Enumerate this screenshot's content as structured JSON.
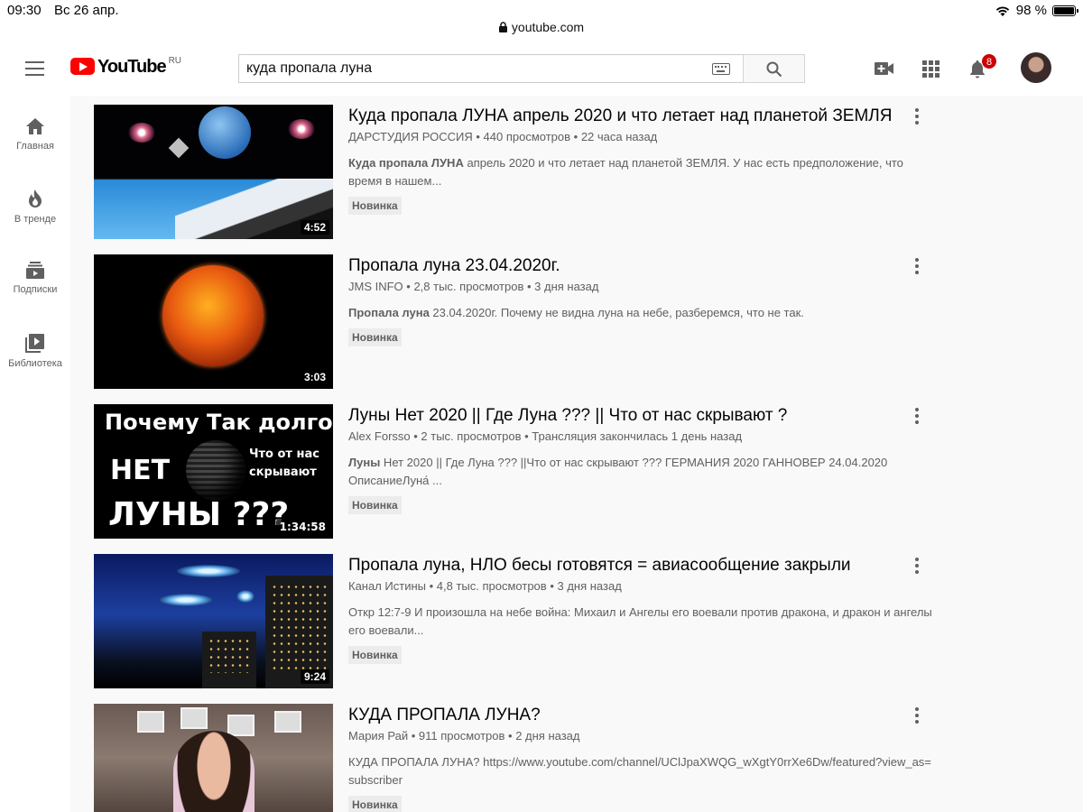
{
  "status_bar": {
    "time": "09:30",
    "date": "Вс 26 апр.",
    "battery": "98 %"
  },
  "url": "youtube.com",
  "logo": {
    "word": "YouTube",
    "country": "RU"
  },
  "search": {
    "query": "куда пропала луна"
  },
  "notifications_count": "8",
  "sidebar": {
    "items": [
      {
        "label": "Главная",
        "icon": "home-icon"
      },
      {
        "label": "В тренде",
        "icon": "flame-icon"
      },
      {
        "label": "Подписки",
        "icon": "subscriptions-icon"
      },
      {
        "label": "Библиотека",
        "icon": "library-icon"
      }
    ]
  },
  "results": [
    {
      "title": "Куда пропала ЛУНА апрель 2020 и что летает над планетой ЗЕМЛЯ",
      "channel": "ДАРСТУДИЯ РОССИЯ",
      "views": "440 просмотров",
      "age": "22 часа назад",
      "desc_bold": "Куда пропала ЛУНА",
      "desc_rest": " апрель 2020 и что летает над планетой ЗЕМЛЯ. У нас есть предположение, что время в нашем...",
      "duration": "4:52",
      "badge": "Новинка"
    },
    {
      "title": "Пропала луна 23.04.2020г.",
      "channel": "JMS INFO",
      "views": "2,8 тыс. просмотров",
      "age": "3 дня назад",
      "desc_bold": "Пропала луна",
      "desc_rest": " 23.04.2020г. Почему не видна луна на небе, разберемся, что не так.",
      "duration": "3:03",
      "badge": "Новинка"
    },
    {
      "title": "Луны Нет 2020 || Где Луна ??? || Что от нас скрывают ?",
      "channel": "Alex Forsso",
      "views": "2 тыс. просмотров",
      "age": "Трансляция закончилась 1 день назад",
      "desc_bold": "Луны",
      "desc_rest": " Нет 2020 || Где Луна ??? ||Что от нас скрывают ??? ГЕРМАНИЯ 2020 ГАННОВЕР 24.04.2020 ОписаниеЛуна́ ...",
      "duration": "1:34:58",
      "badge": "Новинка",
      "thumb_text": [
        "Почему Так долго",
        "НЕТ",
        "ЛУНЫ ???",
        "Что от нас",
        "скрывают"
      ]
    },
    {
      "title": "Пропала луна, НЛО бесы готовятся = авиасообщение закрыли",
      "channel": "Канал Истины",
      "views": "4,8 тыс. просмотров",
      "age": "3 дня назад",
      "desc_bold": "",
      "desc_rest": "Откр 12:7-9 И произошла на небе война: Михаил и Ангелы его воевали против дракона, и дракон и ангелы его воевали...",
      "duration": "9:24",
      "badge": "Новинка"
    },
    {
      "title": "КУДА ПРОПАЛА ЛУНА?",
      "channel": "Мария Рай",
      "views": "911 просмотров",
      "age": "2 дня назад",
      "desc_bold": "",
      "desc_rest": "КУДА ПРОПАЛА ЛУНА? https://www.youtube.com/channel/UClJpaXWQG_wXgtY0rrXe6Dw/featured?view_as=subscriber",
      "duration": "",
      "badge": "Новинка"
    }
  ]
}
